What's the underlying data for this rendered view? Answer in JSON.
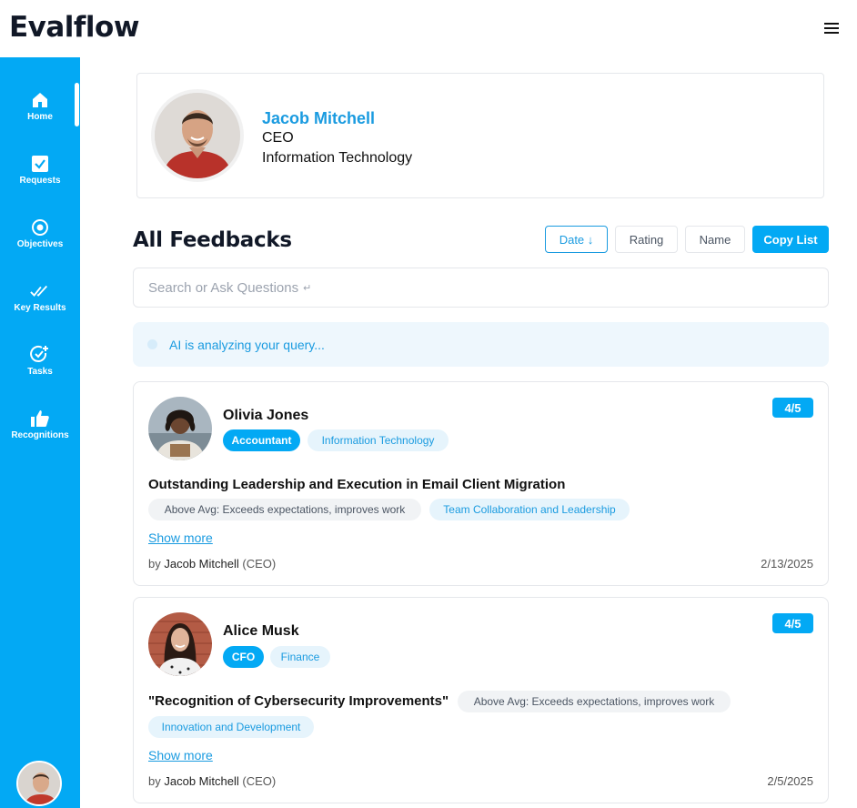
{
  "app": {
    "title": "Evalflow"
  },
  "sidebar": {
    "items": [
      {
        "label": "Home",
        "icon": "home-icon"
      },
      {
        "label": "Requests",
        "icon": "checkbox-icon"
      },
      {
        "label": "Objectives",
        "icon": "target-icon"
      },
      {
        "label": "Key Results",
        "icon": "double-check-icon"
      },
      {
        "label": "Tasks",
        "icon": "task-add-icon"
      },
      {
        "label": "Recognitions",
        "icon": "thumbs-up-icon"
      }
    ],
    "active": "Home"
  },
  "profile": {
    "name": "Jacob Mitchell",
    "role": "CEO",
    "department": "Information Technology"
  },
  "feedbacks": {
    "title": "All Feedbacks",
    "sort": {
      "date_label": "Date ↓",
      "rating_label": "Rating",
      "name_label": "Name",
      "active": "Date"
    },
    "copy_label": "Copy List",
    "search_placeholder": "Search or Ask Questions",
    "ai_status": "AI is analyzing your query...",
    "items": [
      {
        "name": "Olivia Jones",
        "role": "Accountant",
        "department": "Information Technology",
        "rating": "4/5",
        "title": "Outstanding Leadership and Execution in Email Client Migration",
        "tags": [
          "Above Avg: Exceeds expectations, improves work",
          "Team Collaboration and Leadership"
        ],
        "show_more": "Show more",
        "by_prefix": "by",
        "by_name": "Jacob Mitchell",
        "by_role": "(CEO)",
        "date": "2/13/2025"
      },
      {
        "name": "Alice Musk",
        "role": "CFO",
        "department": "Finance",
        "rating": "4/5",
        "title": "\"Recognition of Cybersecurity Improvements\"",
        "tags": [
          "Above Avg: Exceeds expectations, improves work",
          "Innovation and Development"
        ],
        "show_more": "Show more",
        "by_prefix": "by",
        "by_name": "Jacob Mitchell",
        "by_role": "(CEO)",
        "date": "2/5/2025"
      }
    ]
  },
  "colors": {
    "accent": "#03a9f4",
    "link": "#1a9be0",
    "ai_bg": "#eef7fd"
  }
}
